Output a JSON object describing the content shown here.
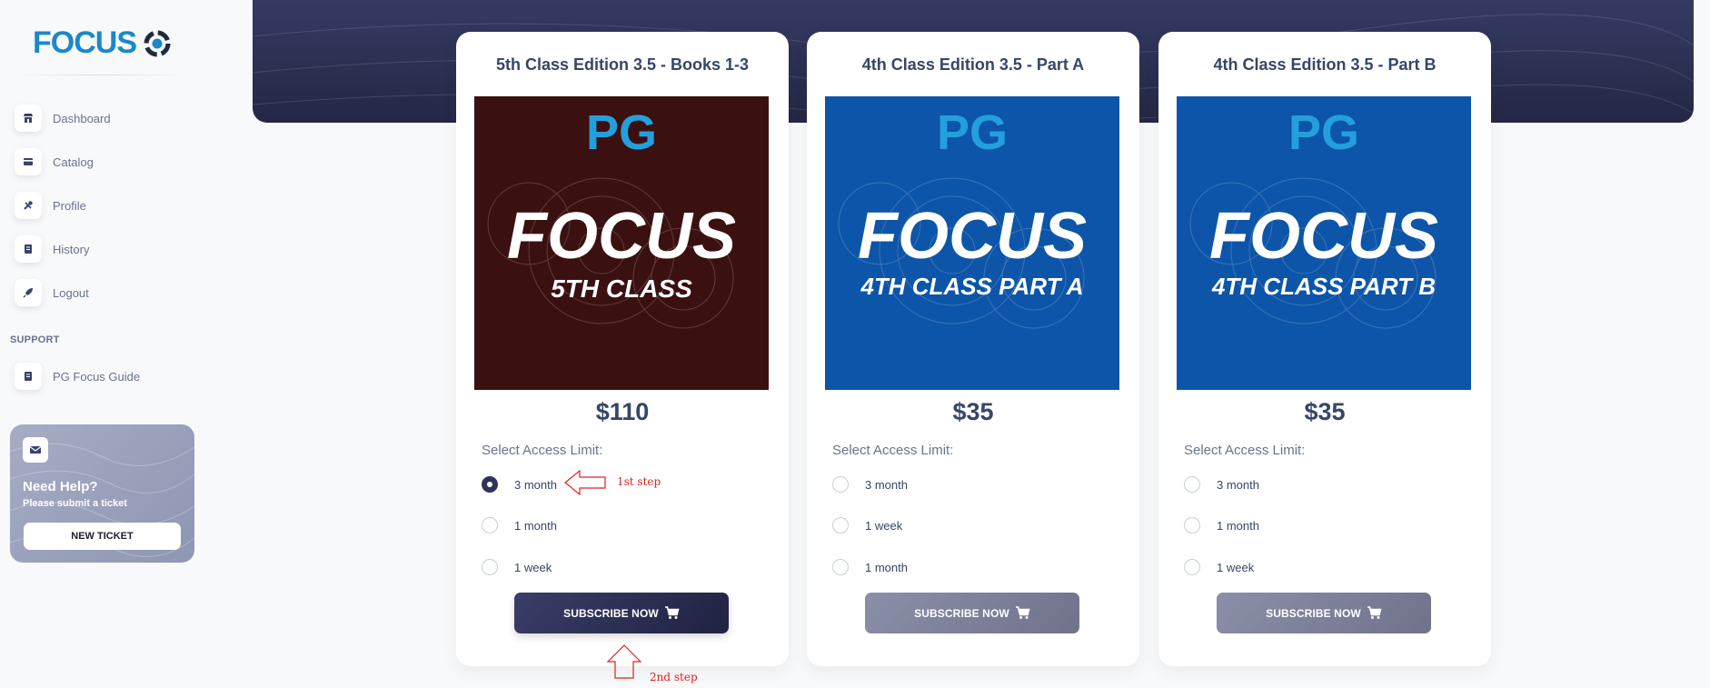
{
  "sidebar": {
    "logo_text": "FOCUS",
    "nav": [
      {
        "label": "Dashboard",
        "icon": "shop-icon"
      },
      {
        "label": "Catalog",
        "icon": "credit-card-icon"
      },
      {
        "label": "Profile",
        "icon": "tools-icon"
      },
      {
        "label": "History",
        "icon": "document-icon"
      },
      {
        "label": "Logout",
        "icon": "rocket-icon"
      }
    ],
    "support_title": "SUPPORT",
    "support_items": [
      {
        "label": "PG Focus Guide",
        "icon": "document-icon"
      }
    ],
    "help": {
      "title": "Need Help?",
      "subtitle": "Please submit a ticket",
      "button": "NEW TICKET",
      "icon": "envelope-icon"
    }
  },
  "cards": [
    {
      "title": "5th Class Edition 3.5 - Books 1-3",
      "cover": {
        "brand": "PG",
        "word": "FOCUS",
        "line": "5TH CLASS",
        "bg": "#3b1010"
      },
      "price": "$110",
      "access_label": "Select Access Limit:",
      "options": [
        {
          "label": "3 month",
          "checked": true
        },
        {
          "label": "1 month",
          "checked": false
        },
        {
          "label": "1 week",
          "checked": false
        }
      ],
      "button": "SUBSCRIBE NOW",
      "button_state": "active"
    },
    {
      "title": "4th Class Edition 3.5 - Part A",
      "cover": {
        "brand": "PG",
        "word": "FOCUS",
        "line": "4TH CLASS PART A",
        "bg": "#0d55a8"
      },
      "price": "$35",
      "access_label": "Select Access Limit:",
      "options": [
        {
          "label": "3 month",
          "checked": false
        },
        {
          "label": "1 week",
          "checked": false
        },
        {
          "label": "1 month",
          "checked": false
        }
      ],
      "button": "SUBSCRIBE NOW",
      "button_state": "disabled"
    },
    {
      "title": "4th Class Edition 3.5 - Part B",
      "cover": {
        "brand": "PG",
        "word": "FOCUS",
        "line": "4TH CLASS PART B",
        "bg": "#0d55a8"
      },
      "price": "$35",
      "access_label": "Select Access Limit:",
      "options": [
        {
          "label": "3 month",
          "checked": false
        },
        {
          "label": "1 month",
          "checked": false
        },
        {
          "label": "1 week",
          "checked": false
        }
      ],
      "button": "SUBSCRIBE NOW",
      "button_state": "disabled"
    }
  ],
  "annotations": {
    "step1": "1st step",
    "step2": "2nd step",
    "color": "#e02020"
  },
  "colors": {
    "accent": "#1a88c9",
    "header_band": "#2c3052",
    "button_active": "#2f3358",
    "button_disabled": "#7c8099"
  }
}
